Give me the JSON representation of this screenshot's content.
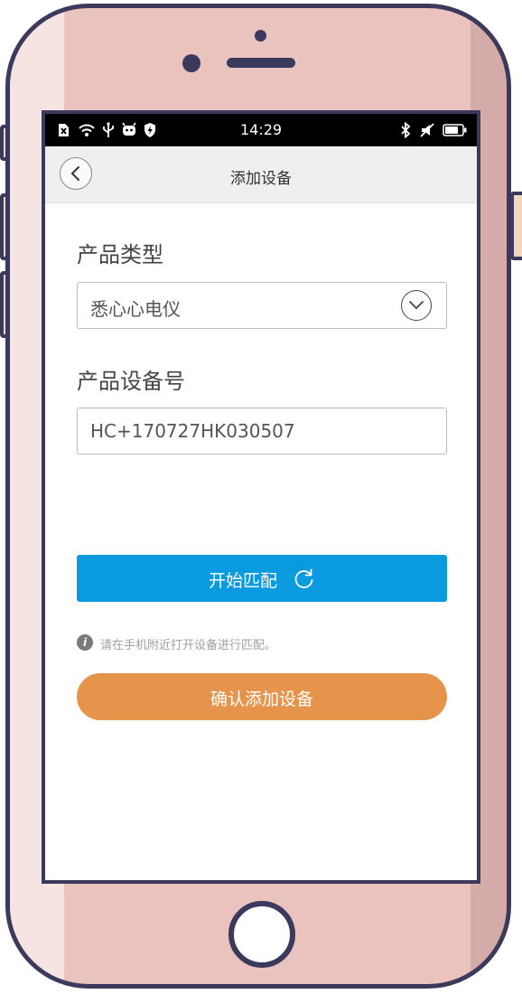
{
  "status_bar": {
    "time": "14:29",
    "left_icons": [
      "sim-error-icon",
      "wifi-icon",
      "usb-icon",
      "android-icon",
      "shield-icon"
    ],
    "right_icons": [
      "bluetooth-icon",
      "mute-icon",
      "battery-icon"
    ]
  },
  "nav": {
    "title": "添加设备",
    "back_icon": "chevron-left-icon"
  },
  "form": {
    "product_type_label": "产品类型",
    "product_type_value": "悉心心电仪",
    "product_number_label": "产品设备号",
    "product_number_value": "HC+170727HK030507"
  },
  "actions": {
    "match_label": "开始匹配",
    "match_icon": "refresh-icon",
    "hint": "请在手机附近打开设备进行匹配。",
    "confirm_label": "确认添加设备"
  },
  "colors": {
    "phone_body": "#ebc3be",
    "phone_outline": "#3c3a5c",
    "match_button": "#0a9ae0",
    "confirm_button": "#e6934c"
  }
}
